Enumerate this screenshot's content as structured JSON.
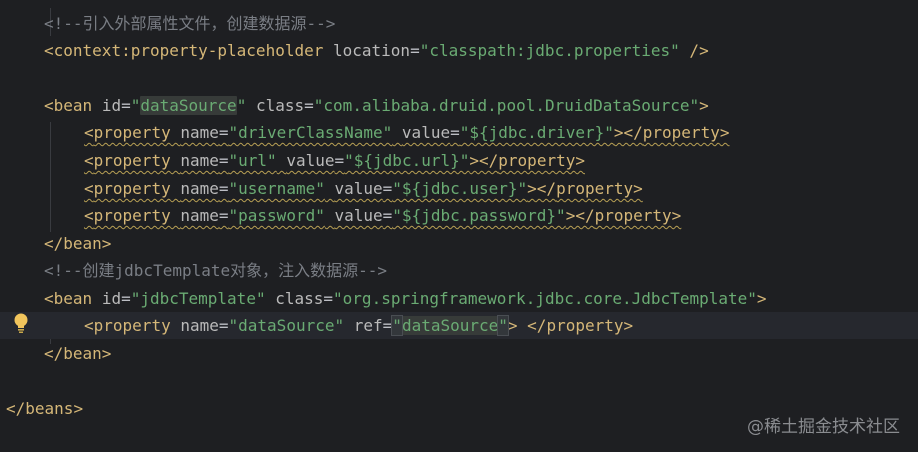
{
  "editor": {
    "theme_colors": {
      "background": "#1e1f22",
      "comment": "#7a7e85",
      "tag": "#d5b778",
      "attribute": "#bababa",
      "string": "#6aab73",
      "warning_underline": "#b8a054",
      "current_line": "#26282e"
    },
    "lines": {
      "l1": {
        "text": "<!--引入外部属性文件，创建数据源-->"
      },
      "l2": {
        "open": "<",
        "tag": "context:property-placeholder",
        "sp1": " ",
        "a1": "location",
        "eq1": "=",
        "v1": "\"classpath:jdbc.properties\"",
        "close": " />"
      },
      "l4": {
        "open": "<",
        "tag": "bean",
        "sp1": " ",
        "a1": "id",
        "eq1": "=",
        "q1a": "\"",
        "v1": "dataSource",
        "q1b": "\"",
        "sp2": " ",
        "a2": "class",
        "eq2": "=",
        "v2": "\"com.alibaba.druid.pool.DruidDataSource\"",
        "close": ">"
      },
      "l5": {
        "open": "<",
        "tag": "property",
        "sp1": " ",
        "a1": "name",
        "eq1": "=",
        "v1": "\"driverClassName\"",
        "sp2": " ",
        "a2": "value",
        "eq2": "=",
        "v2": "\"${jdbc.driver}\"",
        "mid": "></",
        "tag2": "property",
        "close": ">"
      },
      "l6": {
        "open": "<",
        "tag": "property",
        "sp1": " ",
        "a1": "name",
        "eq1": "=",
        "v1": "\"url\"",
        "sp2": " ",
        "a2": "value",
        "eq2": "=",
        "v2": "\"${jdbc.url}\"",
        "mid": "></",
        "tag2": "property",
        "close": ">"
      },
      "l7": {
        "open": "<",
        "tag": "property",
        "sp1": " ",
        "a1": "name",
        "eq1": "=",
        "v1": "\"username\"",
        "sp2": " ",
        "a2": "value",
        "eq2": "=",
        "v2": "\"${jdbc.user}\"",
        "mid": "></",
        "tag2": "property",
        "close": ">"
      },
      "l8": {
        "open": "<",
        "tag": "property",
        "sp1": " ",
        "a1": "name",
        "eq1": "=",
        "v1": "\"password\"",
        "sp2": " ",
        "a2": "value",
        "eq2": "=",
        "v2": "\"${jdbc.password}\"",
        "mid": "></",
        "tag2": "property",
        "close": ">"
      },
      "l9": {
        "open": "</",
        "tag": "bean",
        "close": ">"
      },
      "l10": {
        "text": "<!--创建jdbcTemplate对象，注入数据源-->"
      },
      "l11": {
        "open": "<",
        "tag": "bean",
        "sp1": " ",
        "a1": "id",
        "eq1": "=",
        "v1": "\"jdbcTemplate\"",
        "sp2": " ",
        "a2": "class",
        "eq2": "=",
        "v2": "\"org.springframework.jdbc.core.JdbcTemplate\"",
        "close": ">"
      },
      "l12": {
        "open": "<",
        "tag": "property",
        "sp1": " ",
        "a1": "name",
        "eq1": "=",
        "v1": "\"dataSource\"",
        "sp2": " ",
        "a2": "ref",
        "eq2": "=",
        "q2a": "\"",
        "v2": "dataSource",
        "q2b": "\"",
        "mid": "> </",
        "tag2": "property",
        "close": ">"
      },
      "l13": {
        "open": "</",
        "tag": "bean",
        "close": ">"
      },
      "l15": {
        "open": "</",
        "tag": "beans",
        "close": ">"
      }
    },
    "gutter_icon": "lightbulb-icon"
  },
  "watermark": "@稀土掘金技术社区"
}
